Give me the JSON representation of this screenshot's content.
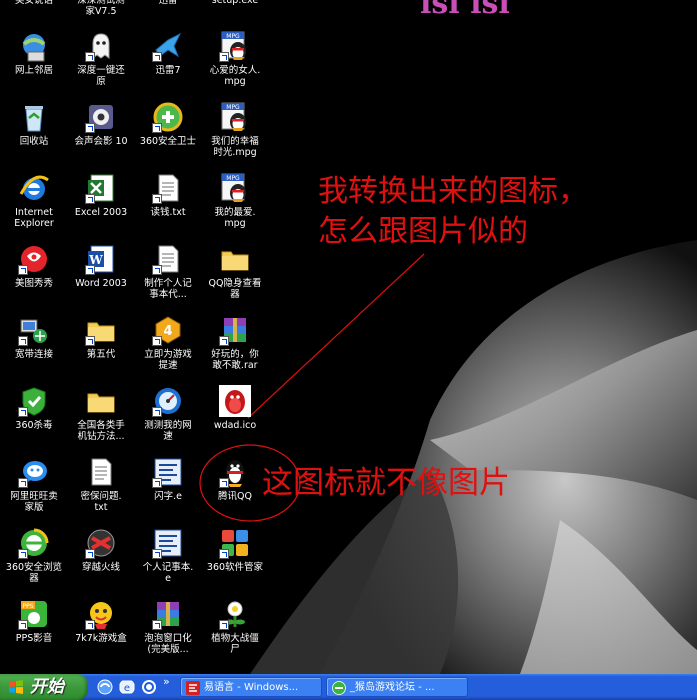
{
  "desktop": {
    "top_partial_text": "ıšı  ıšı",
    "icons": [
      {
        "label": "美女说话",
        "icon": "partial-top-icon"
      },
      {
        "label": "深深测试测\n家V7.5",
        "icon": "partial-top-icon"
      },
      {
        "label": "迅雷",
        "icon": "partial-top-icon"
      },
      {
        "label": "setup.exe",
        "icon": "partial-top-icon"
      },
      {
        "label": "网上邻居",
        "icon": "network-places-icon"
      },
      {
        "label": "深度一键还\n原",
        "icon": "ghost-restore-icon"
      },
      {
        "label": "迅雷7",
        "icon": "thunder-bird-icon"
      },
      {
        "label": "心爱的女人.\nmpg",
        "icon": "mpg-qq-icon"
      },
      {
        "label": "回收站",
        "icon": "recycle-bin-icon"
      },
      {
        "label": "会声会影 10",
        "icon": "video-studio-icon"
      },
      {
        "label": "360安全卫士",
        "icon": "360-safeguard-icon"
      },
      {
        "label": "我们的幸福\n时光.mpg",
        "icon": "mpg-qq-icon"
      },
      {
        "label": "Internet\nExplorer",
        "icon": "internet-explorer-icon"
      },
      {
        "label": "Excel 2003",
        "icon": "excel-icon"
      },
      {
        "label": "读钱.txt",
        "icon": "text-file-icon"
      },
      {
        "label": "我的最爱.\nmpg",
        "icon": "mpg-qq-icon"
      },
      {
        "label": "美图秀秀",
        "icon": "meitu-icon"
      },
      {
        "label": "Word 2003",
        "icon": "word-icon"
      },
      {
        "label": "制作个人记\n事本代...",
        "icon": "text-file-icon"
      },
      {
        "label": "QQ隐身查看\n器",
        "icon": "folder-icon"
      },
      {
        "label": "宽带连接",
        "icon": "broadband-connection-icon"
      },
      {
        "label": "第五代",
        "icon": "folder-icon"
      },
      {
        "label": "立即为游戏\n提速",
        "icon": "game-speedup-icon"
      },
      {
        "label": "好玩的，你\n敢不敢.rar",
        "icon": "rar-archive-icon"
      },
      {
        "label": "360杀毒",
        "icon": "360-antivirus-icon"
      },
      {
        "label": "全国各类手\n机钻方法...",
        "icon": "folder-icon"
      },
      {
        "label": "测测我的网\n速",
        "icon": "speed-test-icon"
      },
      {
        "label": "wdad.ico",
        "icon": "qq-penguin-red-icon"
      },
      {
        "label": "阿里旺旺卖\n家版",
        "icon": "aliwangwang-icon"
      },
      {
        "label": "密保问题.\ntxt",
        "icon": "text-file-icon"
      },
      {
        "label": "闪字.e",
        "icon": "e-language-icon"
      },
      {
        "label": "腾讯QQ",
        "icon": "qq-penguin-icon"
      },
      {
        "label": "360安全浏览\n器",
        "icon": "360-browser-icon"
      },
      {
        "label": "穿越火线",
        "icon": "crossfire-icon"
      },
      {
        "label": "个人记事本.\ne",
        "icon": "e-language-icon"
      },
      {
        "label": "360软件管家",
        "icon": "360-software-manager-icon"
      },
      {
        "label": "PPS影音",
        "icon": "pps-player-icon"
      },
      {
        "label": "7k7k游戏盒",
        "icon": "7k7k-game-box-icon"
      },
      {
        "label": "泡泡窗口化\n(完美版...",
        "icon": "rar-archive-icon"
      },
      {
        "label": "植物大战僵\n尸",
        "icon": "plants-vs-zombies-icon"
      }
    ],
    "annotation_1": "我转换出来的图标，\n怎么跟图片似的",
    "annotation_2": "这图标就不像图片"
  },
  "taskbar": {
    "start_label": "开始",
    "quick_launch": [
      "show-desktop-icon",
      "ie-quicklaunch-icon",
      "browser-quicklaunch-icon"
    ],
    "overflow": "»",
    "tasks": [
      {
        "label": "易语言 - Windows...",
        "icon": "e-language-task-icon"
      },
      {
        "label": "_猴岛游戏论坛 - ...",
        "icon": "360-browser-task-icon"
      }
    ]
  },
  "colors": {
    "annotation": "#e01010",
    "taskbar": "#245edb",
    "start": "#3c9a3c"
  }
}
